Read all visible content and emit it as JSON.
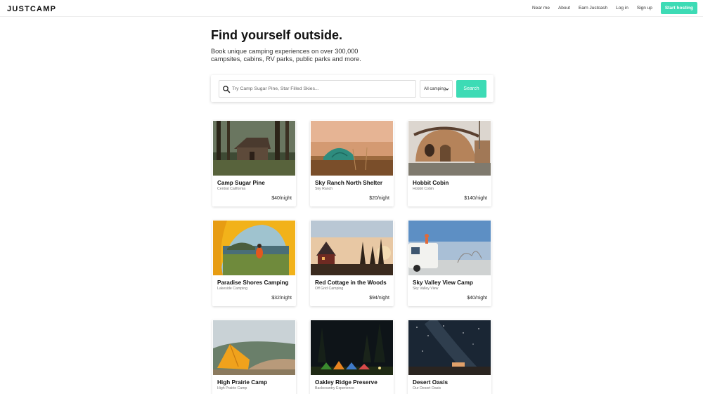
{
  "header": {
    "logo": "JUSTCAMP",
    "nav": [
      "Near me",
      "About",
      "Earn Justcash",
      "Log in",
      "Sign up"
    ],
    "cta": "Start hosting",
    "accent_color": "#3ddbb5"
  },
  "hero": {
    "title": "Find yourself outside.",
    "subtitle": "Book unique camping experiences on over 300,000 campsites, cabins, RV parks, public parks and more."
  },
  "search": {
    "icon": "search-icon",
    "placeholder": "Try Camp Sugar Pine, Star Filled Skies...",
    "value": "",
    "filter_selected": "All camping",
    "button_label": "Search"
  },
  "listings": [
    {
      "title": "Camp Sugar Pine",
      "subtitle": "Central California",
      "price": "$40/night"
    },
    {
      "title": "Sky Ranch North Shelter",
      "subtitle": "Sky Ranch",
      "price": "$20/night"
    },
    {
      "title": "Hobbit Cobin",
      "subtitle": "Hobbit Cobin",
      "price": "$140/night"
    },
    {
      "title": "Paradise Shores Camping",
      "subtitle": "Lakeside Camping",
      "price": "$32/night"
    },
    {
      "title": "Red Cottage in the Woods",
      "subtitle": "Off Grid Camping",
      "price": "$94/night"
    },
    {
      "title": "Sky Valley View Camp",
      "subtitle": "Sky Valley View",
      "price": "$40/night"
    },
    {
      "title": "High Prairie Camp",
      "subtitle": "High Prairie Camp",
      "price": ""
    },
    {
      "title": "Oakley Ridge Preserve",
      "subtitle": "Backcountry Experience",
      "price": ""
    },
    {
      "title": "Desert Oasis",
      "subtitle": "Our Desert Oasis",
      "price": ""
    }
  ]
}
